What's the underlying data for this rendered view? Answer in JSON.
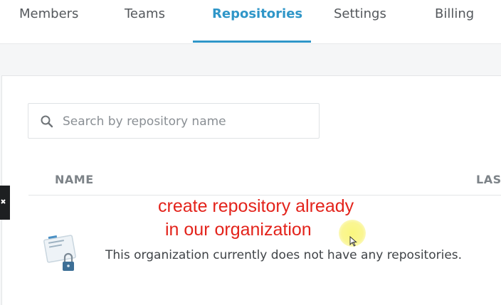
{
  "tabs": [
    {
      "label": "Members",
      "active": false
    },
    {
      "label": "Teams",
      "active": false
    },
    {
      "label": "Repositories",
      "active": true
    },
    {
      "label": "Settings",
      "active": false
    },
    {
      "label": "Billing",
      "active": false
    }
  ],
  "search": {
    "placeholder": "Search by repository name",
    "value": "",
    "icon": "search-icon"
  },
  "table": {
    "columns": [
      "NAME",
      "LAST"
    ]
  },
  "empty_state": {
    "message": "This organization currently does not have any repositories.",
    "icon": "locked-repository-icon"
  },
  "annotation": {
    "line1": "create repository already",
    "line2": "in our organization",
    "color": "#e3231b"
  },
  "colors": {
    "accent": "#2f96c8",
    "tab_text": "#54585c",
    "column_header": "#7d8388"
  }
}
